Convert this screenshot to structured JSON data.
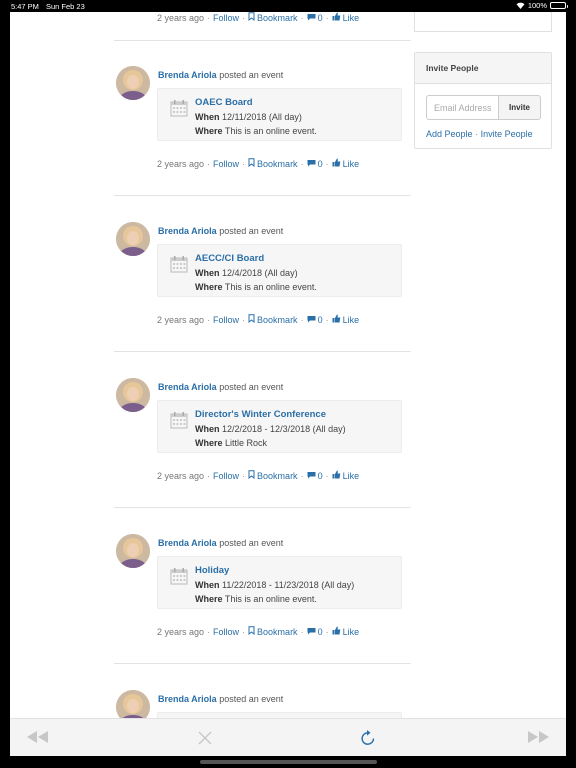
{
  "status_bar": {
    "time": "5:47 PM",
    "date": "Sun Feb 23",
    "battery": "100%"
  },
  "top_partial": {
    "time_ago": "2 years ago",
    "follow": "Follow",
    "bookmark": "Bookmark",
    "comments": "0",
    "like": "Like"
  },
  "invite_widget": {
    "title": "Invite People",
    "email_placeholder": "Email Address",
    "invite_button": "Invite",
    "add_people": "Add People",
    "separator": "·",
    "invite_people": "Invite People"
  },
  "feed": [
    {
      "author": "Brenda Ariola",
      "action": "posted an event",
      "event_title": "OAEC Board",
      "when_label": "When",
      "when": "12/11/2018 (All day)",
      "where_label": "Where",
      "where": "This is an online event.",
      "time_ago": "2 years ago",
      "follow": "Follow",
      "bookmark": "Bookmark",
      "comments": "0",
      "like": "Like"
    },
    {
      "author": "Brenda Ariola",
      "action": "posted an event",
      "event_title": "AECC/CI Board",
      "when_label": "When",
      "when": "12/4/2018 (All day)",
      "where_label": "Where",
      "where": "This is an online event.",
      "time_ago": "2 years ago",
      "follow": "Follow",
      "bookmark": "Bookmark",
      "comments": "0",
      "like": "Like"
    },
    {
      "author": "Brenda Ariola",
      "action": "posted an event",
      "event_title": "Director's Winter Conference",
      "when_label": "When",
      "when": "12/2/2018 - 12/3/2018 (All day)",
      "where_label": "Where",
      "where": "Little Rock",
      "time_ago": "2 years ago",
      "follow": "Follow",
      "bookmark": "Bookmark",
      "comments": "0",
      "like": "Like"
    },
    {
      "author": "Brenda Ariola",
      "action": "posted an event",
      "event_title": "Holiday",
      "when_label": "When",
      "when": "11/22/2018 - 11/23/2018 (All day)",
      "where_label": "Where",
      "where": "This is an online event.",
      "time_ago": "2 years ago",
      "follow": "Follow",
      "bookmark": "Bookmark",
      "comments": "0",
      "like": "Like"
    },
    {
      "author": "Brenda Ariola",
      "action": "posted an event"
    }
  ],
  "toolbar_icons": [
    "back-icon",
    "stop-icon",
    "reload-icon",
    "forward-icon"
  ],
  "colors": {
    "link": "#2a6fa8",
    "toolbar_icon": "#2a6fa8",
    "disabled_icon": "#c7c7c7"
  }
}
